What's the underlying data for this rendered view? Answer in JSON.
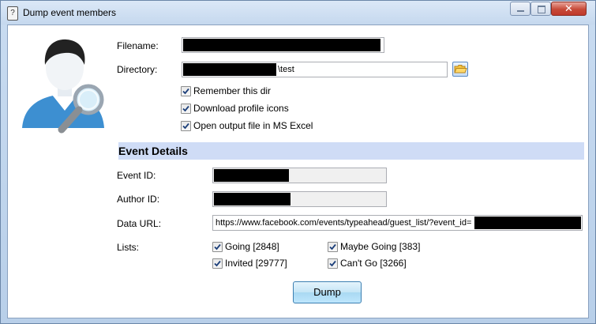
{
  "window": {
    "title": "Dump event members",
    "app_icon_glyph": "?",
    "close_glyph": "✕"
  },
  "form": {
    "filename_label": "Filename:",
    "filename_value": "",
    "directory_label": "Directory:",
    "directory_value": "\\test",
    "options": [
      {
        "label": "Remember this dir",
        "checked": true
      },
      {
        "label": "Download profile icons",
        "checked": true
      },
      {
        "label": "Open output file in MS Excel",
        "checked": true
      }
    ]
  },
  "event_details": {
    "section_title": "Event Details",
    "event_id_label": "Event ID:",
    "author_id_label": "Author ID:",
    "data_url_label": "Data URL:",
    "data_url_value": "https://www.facebook.com/events/typeahead/guest_list/?event_id=",
    "lists_label": "Lists:",
    "lists": [
      {
        "label": "Going [2848]",
        "checked": true
      },
      {
        "label": "Maybe Going [383]",
        "checked": true
      },
      {
        "label": "Invited [29777]",
        "checked": true
      },
      {
        "label": "Can't Go [3266]",
        "checked": true
      }
    ]
  },
  "actions": {
    "dump_label": "Dump"
  },
  "icons": {
    "app": "app-icon",
    "avatar": "user-search-icon",
    "browse": "folder-icon",
    "minimize": "minimize-icon",
    "maximize": "maximize-icon",
    "close": "close-icon"
  },
  "colors": {
    "section_bar": "#cfdcf6",
    "close_button": "#c74a38",
    "avatar_shirt": "#3d8fd1"
  }
}
